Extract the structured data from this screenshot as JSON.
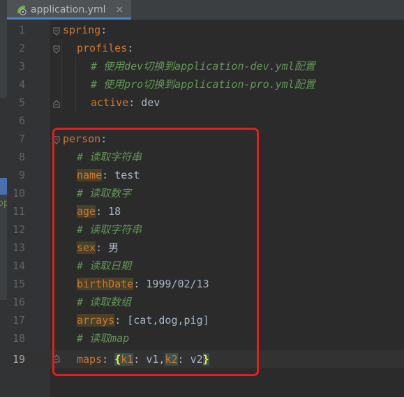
{
  "colors": {
    "background": "#2b2b2b",
    "key": "#cc7832",
    "comment": "#629755",
    "value": "#a9b7c6",
    "highlight_box": "#e02020"
  },
  "sidebar_fragment": "op",
  "tab": {
    "icon": "yaml-spring-icon",
    "label": "application.yml",
    "close_label": "×"
  },
  "line_numbers": [
    "1",
    "2",
    "3",
    "4",
    "5",
    "6",
    "7",
    "8",
    "9",
    "10",
    "11",
    "12",
    "13",
    "14",
    "15",
    "16",
    "17",
    "18",
    "19"
  ],
  "lines": {
    "l1": {
      "key": "spring",
      "colon": ":"
    },
    "l2": {
      "key": "profiles",
      "colon": ":"
    },
    "l3": {
      "comment": "# 使用dev切换到application-dev.yml配置"
    },
    "l4": {
      "comment": "# 使用pro切换到application-pro.yml配置"
    },
    "l5": {
      "key": "active",
      "colon": ": ",
      "value": "dev"
    },
    "l7": {
      "key": "person",
      "colon": ":"
    },
    "l8": {
      "comment": "# 读取字符串"
    },
    "l9": {
      "key": "name",
      "colon": ": ",
      "value": "test"
    },
    "l10": {
      "comment": "# 读取数字"
    },
    "l11": {
      "key": "age",
      "colon": ": ",
      "value": "18"
    },
    "l12": {
      "comment": "# 读取字符串"
    },
    "l13": {
      "key": "sex",
      "colon": ": ",
      "value": "男"
    },
    "l14": {
      "comment": "# 读取日期"
    },
    "l15": {
      "key": "birthDate",
      "colon": ": ",
      "value": "1999/02/13"
    },
    "l16": {
      "comment": "# 读取数组"
    },
    "l17": {
      "key": "arrays",
      "colon": ": ",
      "value": "[cat,dog,pig]"
    },
    "l18": {
      "comment": "# 读取map"
    },
    "l19": {
      "key": "maps",
      "colon": ": ",
      "open_brace": "{",
      "k1": "k1",
      "k1_sep": ": ",
      "v1": "v1",
      "comma": ",",
      "k2": "k2",
      "k2_sep": ": ",
      "v2": "v2",
      "close_brace": "}"
    }
  }
}
